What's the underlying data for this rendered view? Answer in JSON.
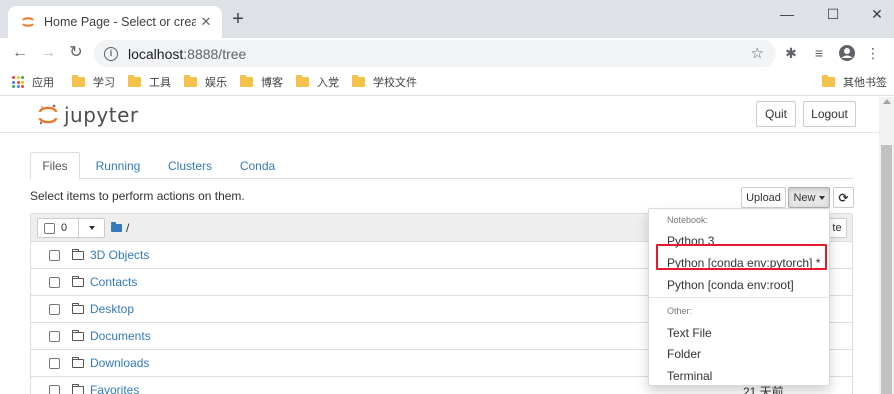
{
  "browser": {
    "tab_title": "Home Page - Select or create a notebook",
    "url_host": "localhost",
    "url_rest": ":8888/tree",
    "bookmarks": [
      {
        "label": "应用",
        "icon": "apps-grid-icon"
      },
      {
        "label": "学习",
        "icon": "folder-icon"
      },
      {
        "label": "工具",
        "icon": "folder-icon"
      },
      {
        "label": "娱乐",
        "icon": "folder-icon"
      },
      {
        "label": "博客",
        "icon": "folder-icon"
      },
      {
        "label": "入党",
        "icon": "folder-icon"
      },
      {
        "label": "学校文件",
        "icon": "folder-icon"
      }
    ],
    "other_bookmarks": "其他书签"
  },
  "header": {
    "logo_text": "jupyter",
    "quit_label": "Quit",
    "logout_label": "Logout"
  },
  "tabs": [
    {
      "label": "Files",
      "active": true
    },
    {
      "label": "Running",
      "active": false
    },
    {
      "label": "Clusters",
      "active": false
    },
    {
      "label": "Conda",
      "active": false
    }
  ],
  "toolbar": {
    "hint": "Select items to perform actions on them.",
    "upload_label": "Upload",
    "new_label": "New"
  },
  "list": {
    "selected_count": "0",
    "breadcrumb_sep": "/",
    "partial_button": "te",
    "rows": [
      {
        "name": "3D Objects",
        "time": ""
      },
      {
        "name": "Contacts",
        "time": ""
      },
      {
        "name": "Desktop",
        "time": ""
      },
      {
        "name": "Documents",
        "time": ""
      },
      {
        "name": "Downloads",
        "time": ""
      },
      {
        "name": "Favorites",
        "time": "21 天前"
      }
    ]
  },
  "new_menu": {
    "notebook_header": "Notebook:",
    "notebook_items": [
      "Python 3",
      "Python [conda env:pytorch] *",
      "Python [conda env:root]"
    ],
    "other_header": "Other:",
    "other_items": [
      "Text File",
      "Folder",
      "Terminal"
    ]
  },
  "colors": {
    "link": "#337ab7",
    "highlight": "#e21b2d",
    "jupyter_orange": "#f37626"
  }
}
